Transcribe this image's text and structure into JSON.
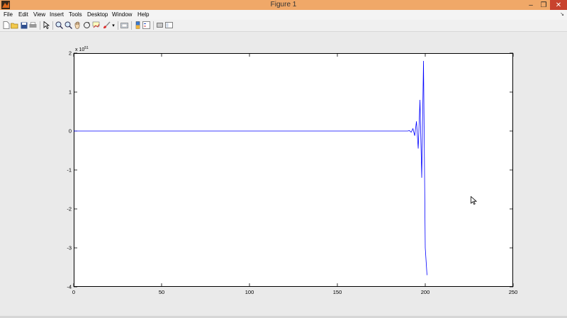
{
  "window": {
    "title": "Figure 1"
  },
  "window_controls": {
    "minimize": "–",
    "restore": "❐",
    "close": "✕"
  },
  "menu": [
    "File",
    "Edit",
    "View",
    "Insert",
    "Tools",
    "Desktop",
    "Window",
    "Help"
  ],
  "menu_overflow": "↘",
  "toolbar": [
    "new-figure",
    "open-file",
    "save",
    "print",
    "edit-plot",
    "zoom-in",
    "zoom-out",
    "pan",
    "rotate-3d",
    "data-cursor",
    "brush",
    "link-plot",
    "insert-colorbar",
    "insert-legend",
    "hide-plot-tools",
    "show-plot-tools"
  ],
  "axes": {
    "exponent": "x 10",
    "exponent_power": "51"
  },
  "chart_data": {
    "type": "line",
    "xlim": [
      0,
      250
    ],
    "ylim": [
      -4,
      2
    ],
    "xticks": [
      "0",
      "50",
      "100",
      "150",
      "200",
      "250"
    ],
    "yticks": [
      "2",
      "1",
      "0",
      "-1",
      "-2",
      "-3",
      "-4"
    ],
    "y_multiplier": "1e51",
    "color": "#0000ff",
    "series": [
      {
        "x": [
          0,
          150,
          190,
          191,
          192,
          193,
          194,
          195,
          196,
          197,
          198,
          199,
          200,
          201
        ],
        "y": [
          0,
          0,
          0,
          0.01,
          -0.03,
          0.06,
          -0.12,
          0.25,
          -0.45,
          0.8,
          -1.2,
          1.8,
          -3.0,
          -3.7
        ]
      }
    ]
  }
}
